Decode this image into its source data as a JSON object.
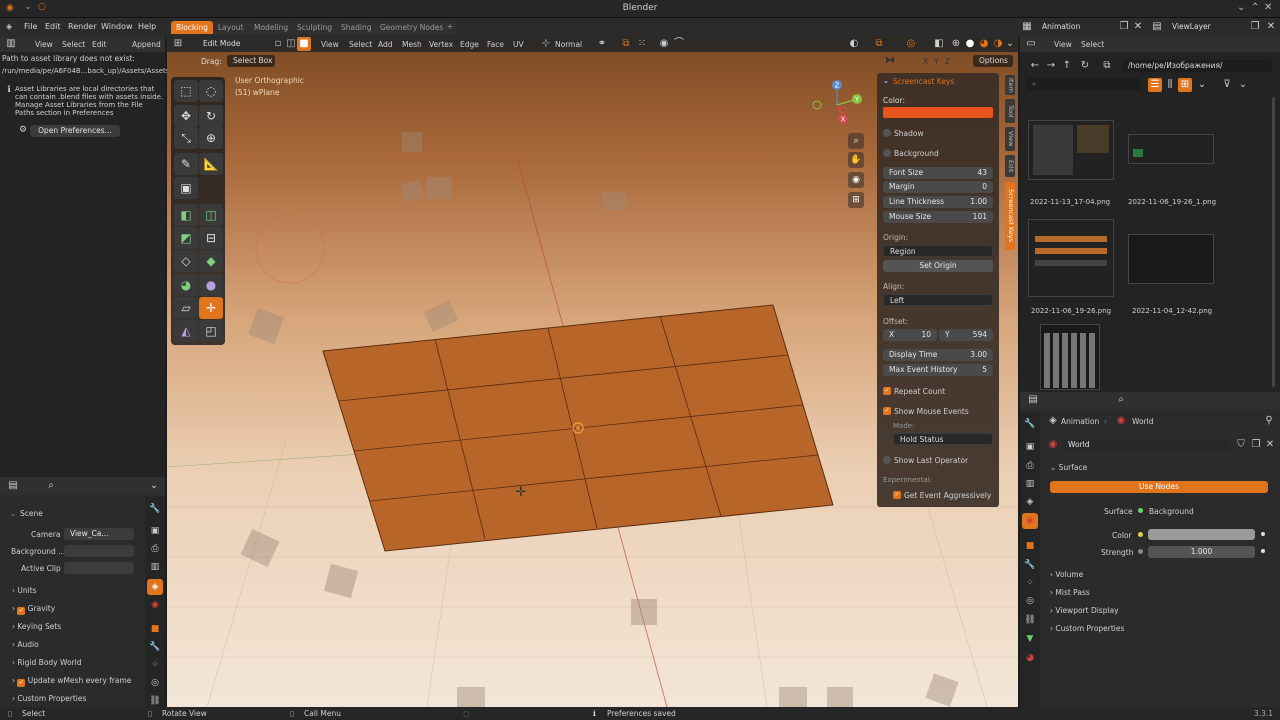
{
  "window_title": "Blender",
  "menu": [
    "File",
    "Edit",
    "Render",
    "Window",
    "Help"
  ],
  "workspaces": [
    "Blocking",
    "Layout",
    "Modeling",
    "Sculpting",
    "Shading",
    "Geometry Nodes"
  ],
  "asset_browser": {
    "menu": [
      "View",
      "Select",
      "Edit"
    ],
    "append_label": "Append",
    "error_line1": "Path to asset library does not exist:",
    "error_line2": "/run/media/pe/A6F04B...back_up)/Assets/Assets",
    "info_lines": [
      "Asset Libraries are local directories that",
      "can contain .blend files with assets inside.",
      "Manage Asset Libraries from the File",
      "Paths section in Preferences"
    ],
    "open_prefs": "Open Preferences..."
  },
  "viewport": {
    "mode": "Edit Mode",
    "menu": [
      "View",
      "Select",
      "Add",
      "Mesh",
      "Vertex",
      "Edge",
      "Face",
      "UV"
    ],
    "orientation": "Normal",
    "drag_label": "Drag:",
    "drag_value": "Select Box",
    "options_label": "Options",
    "axes": [
      "X",
      "Y",
      "Z"
    ],
    "view_name": "User Orthographic",
    "object_name": "(51) wPlane"
  },
  "screencast_panel": {
    "header": "Screencast Keys",
    "color_label": "Color:",
    "color_value": "#e8531e",
    "shadow": "Shadow",
    "background": "Background",
    "font_size_label": "Font Size",
    "font_size": "43",
    "margin_label": "Margin",
    "margin": "0",
    "line_thickness_label": "Line Thickness",
    "line_thickness": "1.00",
    "mouse_size_label": "Mouse Size",
    "mouse_size": "101",
    "origin_label": "Origin:",
    "origin_value": "Region",
    "set_origin": "Set Origin",
    "align_label": "Align:",
    "align_value": "Left",
    "offset_label": "Offset:",
    "offset_x_label": "X",
    "offset_x": "10",
    "offset_y_label": "Y",
    "offset_y": "594",
    "display_time_label": "Display Time",
    "display_time": "3.00",
    "max_history_label": "Max Event History",
    "max_history": "5",
    "repeat_count": "Repeat Count",
    "show_mouse_events": "Show Mouse Events",
    "mode_label": "Mode:",
    "mode_value": "Hold Status",
    "show_last_operator": "Show Last Operator",
    "experimental_label": "Experimental:",
    "get_event_aggressively": "Get Event Aggressively",
    "side_tabs": [
      "Item",
      "Tool",
      "View",
      "Edit",
      "Screencast Keys"
    ]
  },
  "scene_props": {
    "scene_label": "Scene",
    "camera_label": "Camera",
    "camera_value": "View_Ca...",
    "background_label": "Background ...",
    "active_clip_label": "Active Clip",
    "sections": [
      "Units",
      "Gravity",
      "Keying Sets",
      "Audio",
      "Rigid Body World",
      "Update wMesh every frame",
      "Custom Properties"
    ]
  },
  "file_browser": {
    "editor": "Animation",
    "view_layer": "ViewLayer",
    "menu": [
      "View",
      "Select"
    ],
    "path": "/home/pe/Изображения/",
    "files": [
      "2022-11-13_17-04.png",
      "2022-11-06_19-26_1.png",
      "2022-11-06_19-26.png",
      "2022-11-04_12-42.png"
    ]
  },
  "world_props": {
    "breadcrumb_scene": "Animation",
    "breadcrumb_world": "World",
    "world_name": "World",
    "surface_label": "Surface",
    "use_nodes": "Use Nodes",
    "surface_field_label": "Surface",
    "surface_value": "Background",
    "color_label": "Color",
    "strength_label": "Strength",
    "strength_value": "1.000",
    "sections": [
      "Volume",
      "Mist Pass",
      "Viewport Display",
      "Custom Properties"
    ]
  },
  "statusbar": {
    "select": "Select",
    "rotate": "Rotate View",
    "call_menu": "Call Menu",
    "message": "Preferences saved",
    "version": "3.3.1"
  },
  "colors": {
    "accent": "#e0751e",
    "viewport_top": "#8a5a30",
    "viewport_bottom": "#f2e3d3",
    "plane": "#b8652a"
  }
}
